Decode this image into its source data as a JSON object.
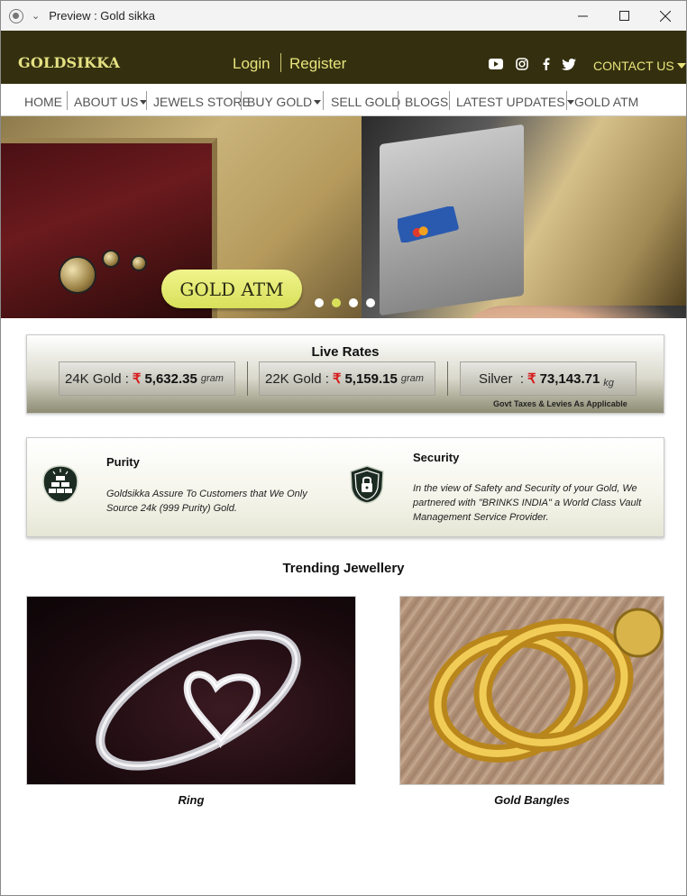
{
  "window": {
    "title": "Preview : Gold sikka",
    "controls": {
      "minimize": "—",
      "maximize": "☐",
      "close": "✕"
    }
  },
  "header": {
    "logo": "GOLDSIKKA",
    "login": "Login",
    "register": "Register",
    "social_icons": [
      "youtube-icon",
      "instagram-icon",
      "facebook-icon",
      "twitter-icon"
    ],
    "contact": "CONTACT US"
  },
  "nav": {
    "items": [
      {
        "label": "HOME"
      },
      {
        "label": "ABOUT US"
      },
      {
        "label": "JEWELS STORE"
      },
      {
        "label": "BUY GOLD"
      },
      {
        "label": "SELL GOLD"
      },
      {
        "label": "BLOGS"
      },
      {
        "label": "LATEST UPDATES"
      },
      {
        "label": "GOLD ATM"
      }
    ]
  },
  "hero": {
    "caption": "GOLD ATM",
    "slides": 4,
    "active_slide": 2
  },
  "live_rates": {
    "title": "Live Rates",
    "rupee_symbol": "₹",
    "items": [
      {
        "label": "24K Gold :",
        "value": "5,632.35",
        "unit": "gram"
      },
      {
        "label": "22K Gold :",
        "value": "5,159.15",
        "unit": "gram"
      },
      {
        "label": "Silver  :",
        "value": "73,143.71",
        "unit": "kg"
      }
    ],
    "note": "Govt Taxes & Levies As Applicable"
  },
  "features": {
    "purity": {
      "title": "Purity",
      "text_line1": "Goldsikka Assure To Customers that We Only",
      "text_line2": "Source 24k (999 Purity) Gold."
    },
    "security": {
      "title": "Security",
      "text_line1": "In the view of Safety and Security of your Gold, We",
      "text_line2": "partnered with \"BRINKS INDIA\" a World Class Vault",
      "text_line3": "Management Service Provider."
    }
  },
  "trending": {
    "title": "Trending Jewellery",
    "products": [
      {
        "label": "Ring"
      },
      {
        "label": "Gold Bangles"
      }
    ]
  },
  "colors": {
    "header_bg": "#34300f",
    "accent": "#e9e47c",
    "hero_pill": "#d8e05a",
    "rupee": "#d71a1a",
    "feature_icon": "#1d2c22"
  }
}
